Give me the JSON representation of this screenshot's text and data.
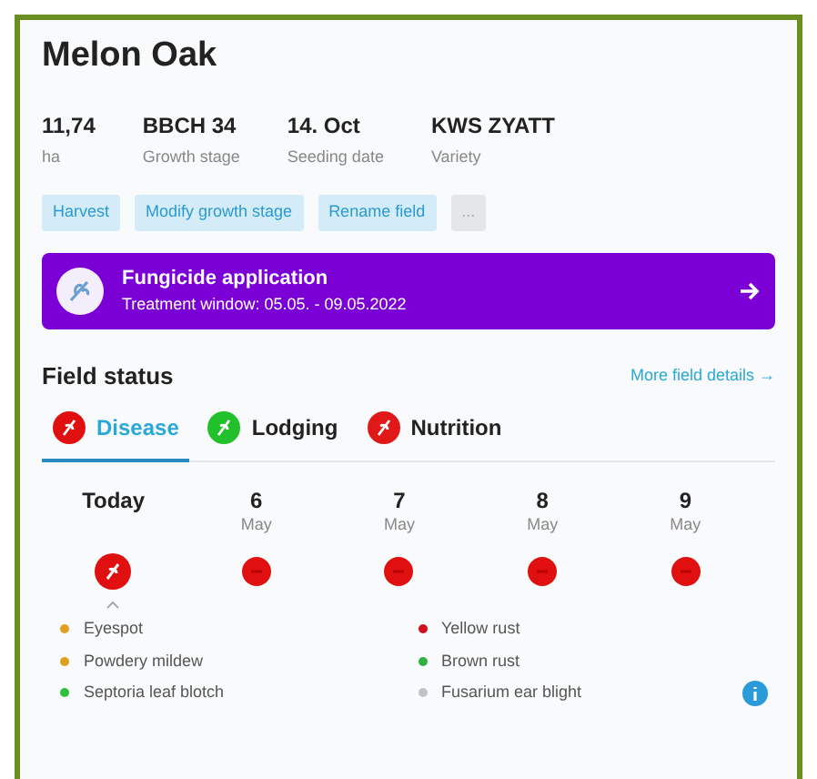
{
  "field": {
    "name": "Melon Oak"
  },
  "stats": [
    {
      "value": "11,74",
      "label": "ha"
    },
    {
      "value": "BBCH 34",
      "label": "Growth stage"
    },
    {
      "value": "14. Oct",
      "label": "Seeding date"
    },
    {
      "value": "KWS ZYATT",
      "label": "Variety"
    }
  ],
  "actions": [
    {
      "label": "Harvest",
      "kind": "chip"
    },
    {
      "label": "Modify growth stage",
      "kind": "chip"
    },
    {
      "label": "Rename field",
      "kind": "chip"
    },
    {
      "label": "...",
      "kind": "more"
    }
  ],
  "banner": {
    "title": "Fungicide application",
    "subtitle": "Treatment window: 05.05. - 09.05.2022"
  },
  "field_status": {
    "title": "Field status",
    "link": "More field details →"
  },
  "tabs": [
    {
      "label": "Disease",
      "color": "#e01010",
      "selected": true
    },
    {
      "label": "Lodging",
      "color": "#22c02a",
      "selected": false
    },
    {
      "label": "Nutrition",
      "color": "#e01818",
      "selected": false
    }
  ],
  "forecast": [
    {
      "day": "Today",
      "kind": "today"
    },
    {
      "day": "6",
      "month": "May",
      "kind": "day"
    },
    {
      "day": "7",
      "month": "May",
      "kind": "day"
    },
    {
      "day": "8",
      "month": "May",
      "kind": "day"
    },
    {
      "day": "9",
      "month": "May",
      "kind": "day"
    }
  ],
  "legend": [
    {
      "label": "Eyespot",
      "color": "#e0a020"
    },
    {
      "label": "Yellow rust",
      "color": "#d01020"
    },
    {
      "label": "Powdery mildew",
      "color": "#e0a020"
    },
    {
      "label": "Brown rust",
      "color": "#30b040"
    },
    {
      "label": "Septoria leaf blotch",
      "color": "#30c040"
    },
    {
      "label": "Fusarium ear blight",
      "color": "#c0c4c8"
    }
  ]
}
